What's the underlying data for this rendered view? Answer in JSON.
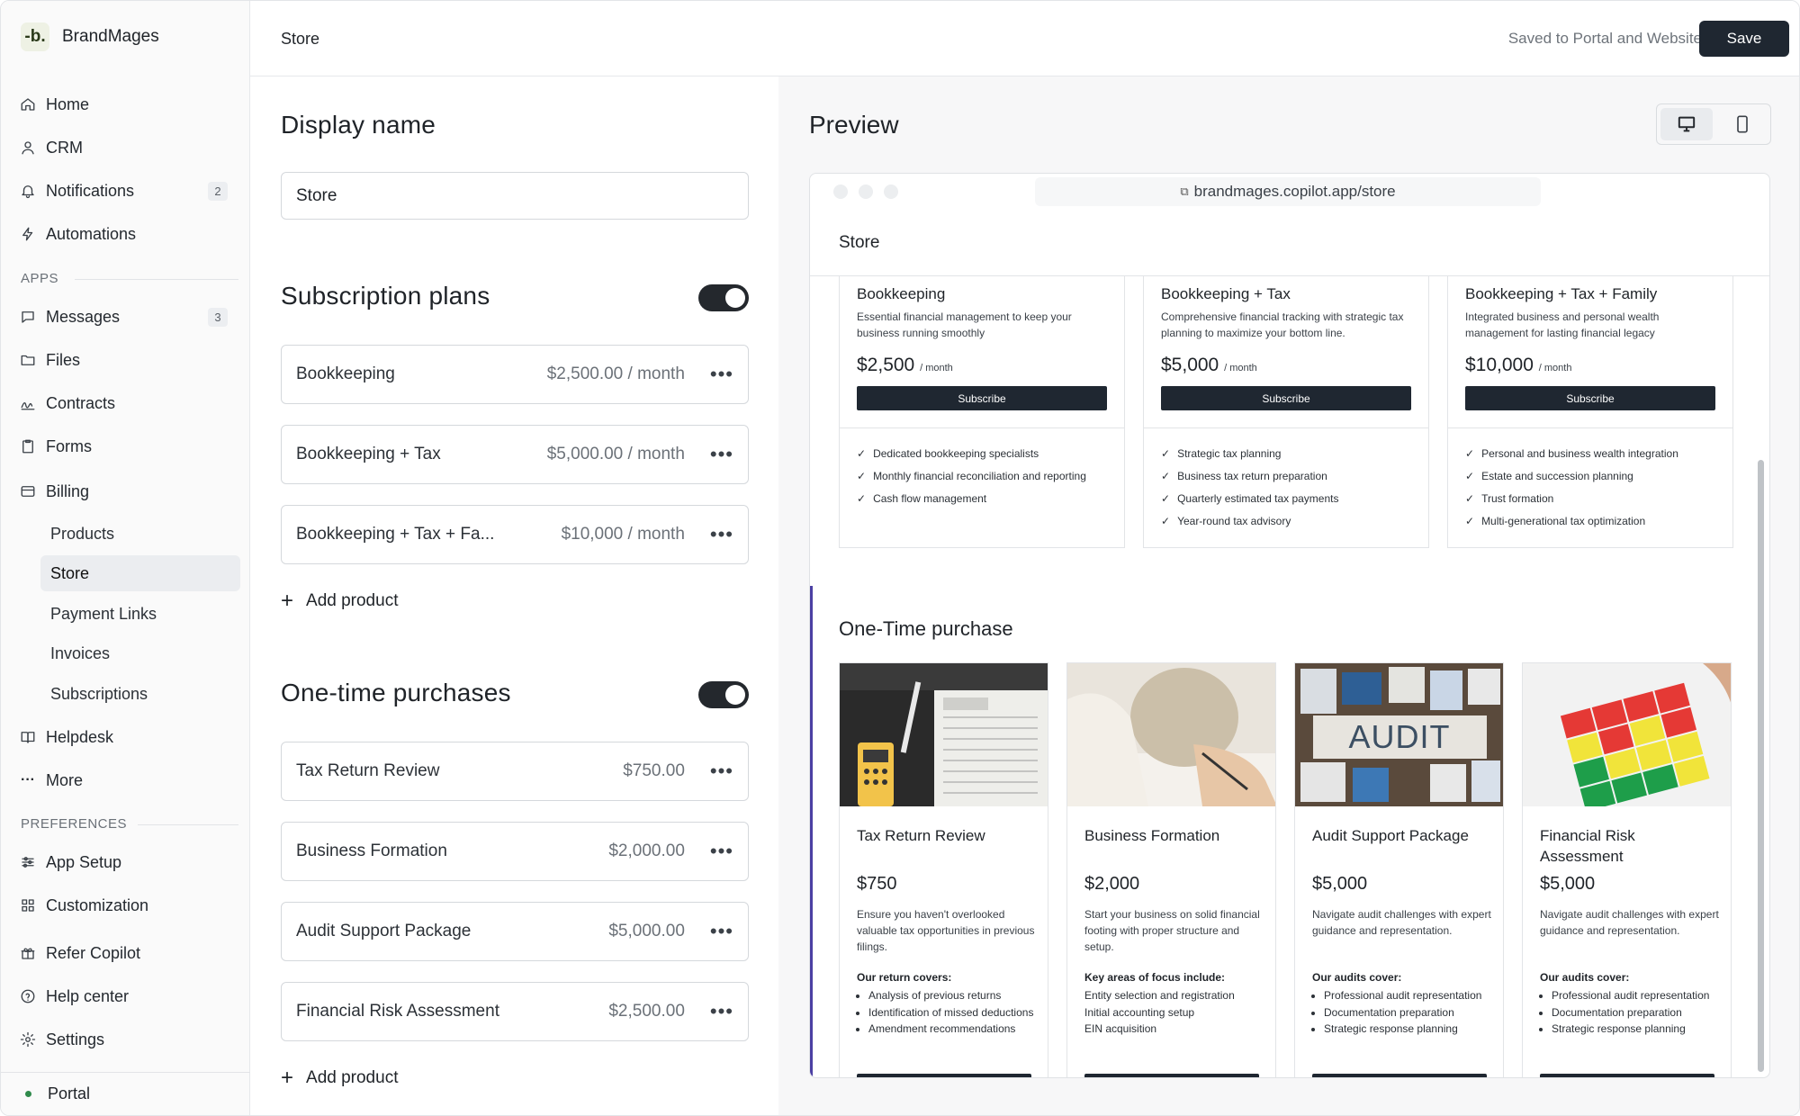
{
  "brand": {
    "logo": "-b.",
    "name": "BrandMages"
  },
  "nav": {
    "home": "Home",
    "crm": "CRM",
    "notifications": "Notifications",
    "notifications_count": "2",
    "automations": "Automations",
    "apps_label": "APPS",
    "messages": "Messages",
    "messages_count": "3",
    "files": "Files",
    "contracts": "Contracts",
    "forms": "Forms",
    "billing": "Billing",
    "billing_sub": {
      "products": "Products",
      "store": "Store",
      "payment_links": "Payment Links",
      "invoices": "Invoices",
      "subscriptions": "Subscriptions"
    },
    "helpdesk": "Helpdesk",
    "more": "More",
    "preferences_label": "PREFERENCES",
    "app_setup": "App Setup",
    "customization": "Customization",
    "refer": "Refer Copilot",
    "help_center": "Help center",
    "settings": "Settings",
    "portal": "Portal"
  },
  "topbar": {
    "title": "Store",
    "saved_status": "Saved to Portal and Website",
    "save_label": "Save"
  },
  "editor": {
    "display_name_heading": "Display name",
    "display_name_value": "Store",
    "subscriptions_heading": "Subscription plans",
    "subscriptions": [
      {
        "name": "Bookkeeping",
        "price": "$2,500.00 / month"
      },
      {
        "name": "Bookkeeping + Tax",
        "price": "$5,000.00 / month"
      },
      {
        "name": "Bookkeeping + Tax + Fa...",
        "price": "$10,000 / month"
      }
    ],
    "add_product": "Add product",
    "one_time_heading": "One-time purchases",
    "one_time": [
      {
        "name": "Tax Return Review",
        "price": "$750.00"
      },
      {
        "name": "Business Formation",
        "price": "$2,000.00"
      },
      {
        "name": "Audit Support Package",
        "price": "$5,000.00"
      },
      {
        "name": "Financial Risk Assessment",
        "price": "$2,500.00"
      }
    ]
  },
  "preview": {
    "heading": "Preview",
    "url": "brandmages.copilot.app/store",
    "site_title": "Store",
    "subscribe_label": "Subscribe",
    "per_month": "/ month",
    "plans": [
      {
        "name": "Bookkeeping",
        "desc": "Essential financial management to keep your business running smoothly",
        "price": "$2,500",
        "features": [
          "Dedicated bookkeeping specialists",
          "Monthly financial reconciliation and reporting",
          "Cash flow management"
        ]
      },
      {
        "name": "Bookkeeping + Tax",
        "desc": "Comprehensive financial tracking with strategic tax planning to maximize your bottom line.",
        "price": "$5,000",
        "features": [
          "Strategic tax planning",
          "Business tax return preparation",
          "Quarterly estimated tax payments",
          "Year-round tax advisory"
        ]
      },
      {
        "name": "Bookkeeping + Tax + Family",
        "desc": "Integrated business and personal wealth management for lasting financial legacy",
        "price": "$10,000",
        "features": [
          "Personal and business wealth integration",
          "Estate and succession planning",
          "Trust formation",
          "Multi-generational tax optimization"
        ]
      }
    ],
    "one_time_heading": "One-Time purchase",
    "products": [
      {
        "name": "Tax Return Review",
        "price": "$750",
        "desc": "Ensure you haven't overlooked valuable tax opportunities in previous filings.",
        "list_heading": "Our return covers:",
        "items": [
          "Analysis of previous returns",
          "Identification of missed deductions",
          "Amendment recommendations"
        ]
      },
      {
        "name": "Business Formation",
        "price": "$2,000",
        "desc": "Start your business on solid financial footing with proper structure and setup.",
        "list_heading": "Key areas of focus include:",
        "items": [
          "Entity selection and registration",
          "Initial accounting setup",
          "EIN acquisition"
        ]
      },
      {
        "name": "Audit Support Package",
        "price": "$5,000",
        "desc": "Navigate audit challenges with expert guidance and representation.",
        "list_heading": "Our audits cover:",
        "items": [
          "Professional audit representation",
          "Documentation preparation",
          "Strategic response planning"
        ],
        "image_text": "AUDIT"
      },
      {
        "name": "Financial Risk Assessment",
        "price": "$5,000",
        "desc": "Navigate audit challenges with expert guidance and representation.",
        "list_heading": "Our audits cover:",
        "items": [
          "Professional audit representation",
          "Documentation preparation",
          "Strategic response planning"
        ]
      }
    ]
  },
  "colors": {
    "primary": "#1f2731",
    "accent_bar": "#4b3fa3",
    "status_dot": "#2f8a4b"
  }
}
